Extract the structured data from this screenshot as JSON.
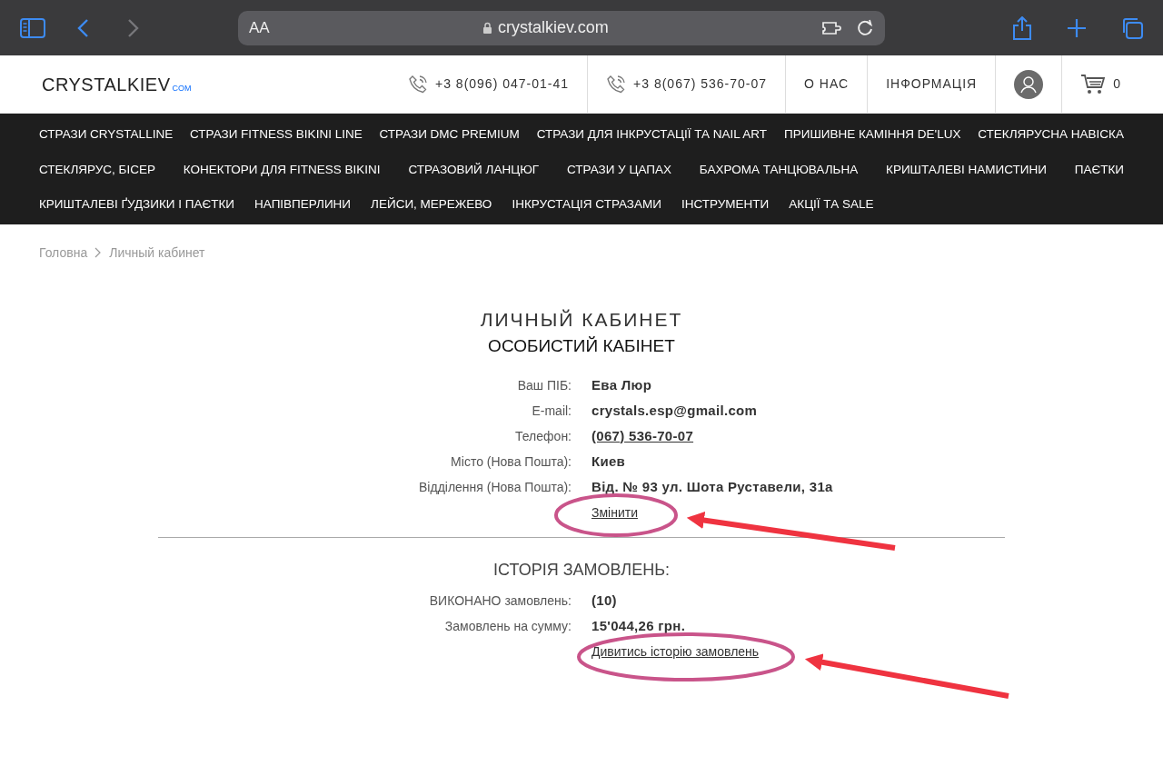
{
  "browser": {
    "back": {
      "disabled": false
    },
    "forward": {
      "disabled": true
    },
    "text_size": "AA",
    "address": "crystalkiev.com"
  },
  "header": {
    "logo": "CRYSTALKIEV",
    "logo_suffix": "COM",
    "phones": [
      "+3 8(096) 047-01-41",
      "+3 8(067) 536-70-07"
    ],
    "links": [
      "О НАС",
      "ІНФОРМАЦІЯ"
    ],
    "cart_count": "0"
  },
  "nav_menu": [
    {
      "items": [
        "СТРАЗИ CRYSTALLINE",
        "СТРАЗИ FITNESS BIKINI LINE",
        "СТРАЗИ DMC PREMIUM",
        "СТРАЗИ ДЛЯ ІНКРУСТАЦІЇ ТА NAIL ART",
        "ПРИШИВНЕ КАМІННЯ DE'LUX",
        "СТЕКЛЯРУСНА НАВІСКА"
      ]
    },
    {
      "items": [
        "СТЕКЛЯРУС, БІСЕР",
        "КОНЕКТОРИ ДЛЯ FITNESS BIKINI",
        "СТРАЗОВИЙ ЛАНЦЮГ",
        "СТРАЗИ У ЦАПАХ",
        "БАХРОМА ТАНЦЮВАЛЬНА",
        "КРИШТАЛЕВІ НАМИСТИНИ",
        "ПАЄТКИ"
      ]
    },
    {
      "items": [
        "КРИШТАЛЕВІ ҐУДЗИКИ І ПАЄТКИ",
        "НАПІВПЕРЛИНИ",
        "ЛЕЙСИ, МЕРЕЖЕВО",
        "ІНКРУСТАЦІЯ СТРАЗАМИ",
        "ІНСТРУМЕНТИ",
        "АКЦІЇ ТА SALE"
      ]
    }
  ],
  "breadcrumb": [
    "Головна",
    "Личный кабинет"
  ],
  "title": "ЛИЧНЫЙ КАБИНЕТ",
  "subtitle": "ОСОБИСТИЙ КАБІНЕТ",
  "profile": {
    "fields": [
      {
        "label": "Ваш ПІБ:",
        "value": "Ева Люр",
        "kind": "text"
      },
      {
        "label": "E-mail:",
        "value": "crystals.esp@gmail.com",
        "kind": "text"
      },
      {
        "label": "Телефон:",
        "value": "(067) 536-70-07",
        "kind": "link"
      },
      {
        "label": "Місто (Нова Пошта):",
        "value": "Киев",
        "kind": "text"
      },
      {
        "label": "Відділення (Нова Пошта):",
        "value": "Від. № 93 ул. Шота Руставели, 31а",
        "kind": "text"
      }
    ],
    "action": "Змінити"
  },
  "orders": {
    "heading": "ІСТОРІЯ ЗАМОВЛЕНЬ:",
    "fields": [
      {
        "label": "ВИКОНАНО замовлень:",
        "value": "(**10**)"
      },
      {
        "label": "Замовлень на сумму:",
        "value": "**15'044,26 грн.**"
      }
    ],
    "action": "Дивитись історію замовлень"
  }
}
